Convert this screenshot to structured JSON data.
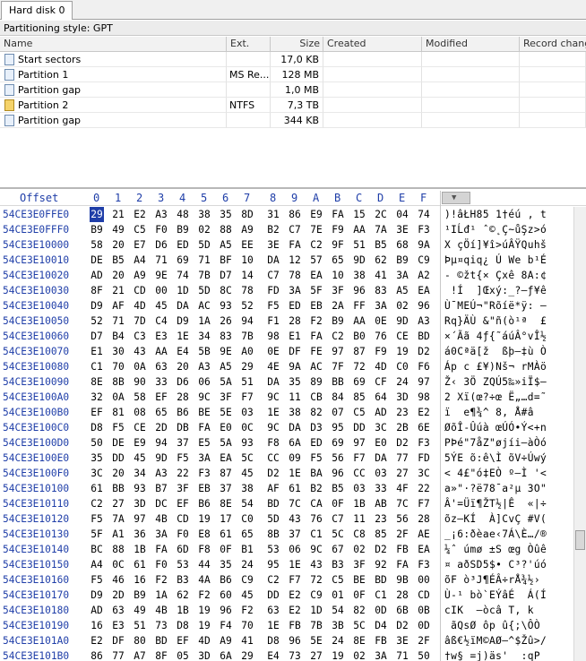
{
  "tab": {
    "label": "Hard disk 0"
  },
  "partition_style": "Partitioning style: GPT",
  "columns": [
    "Name",
    "Ext.",
    "Size",
    "Created",
    "Modified",
    "Record change"
  ],
  "partitions": [
    {
      "name": "Start sectors",
      "fs": "",
      "size": "17,0 KB",
      "icon": "sector-icon"
    },
    {
      "name": "Partition 1",
      "fs": "MS Re...",
      "size": "128 MB",
      "icon": "partition-icon"
    },
    {
      "name": "Partition gap",
      "fs": "",
      "size": "1,0 MB",
      "icon": "gap-icon"
    },
    {
      "name": "Partition 2",
      "fs": "NTFS",
      "size": "7,3 TB",
      "icon": "partition-warning-icon"
    },
    {
      "name": "Partition gap",
      "fs": "",
      "size": "344 KB",
      "icon": "gap-icon"
    }
  ],
  "hex": {
    "offset_label": "Offset",
    "col_labels": [
      "0",
      "1",
      "2",
      "3",
      "4",
      "5",
      "6",
      "7",
      "8",
      "9",
      "A",
      "B",
      "C",
      "D",
      "E",
      "F"
    ],
    "rows": [
      {
        "off": "54CE3E0FFE0",
        "bytes": [
          "29",
          "21",
          "E2",
          "A3",
          "48",
          "38",
          "35",
          "8D",
          "31",
          "86",
          "E9",
          "FA",
          "15",
          "2C",
          "04",
          "74"
        ],
        "ascii": ")!âŁH85 1†éú , t"
      },
      {
        "off": "54CE3E0FFF0",
        "bytes": [
          "B9",
          "49",
          "C5",
          "F0",
          "B9",
          "02",
          "88",
          "A9",
          "B2",
          "C7",
          "7E",
          "F9",
          "AA",
          "7A",
          "3E",
          "F3"
        ],
        "ascii": "¹IĹđ¹ ˆ©˛Ç~ůŞz>ó"
      },
      {
        "off": "54CE3E10000",
        "bytes": [
          "58",
          "20",
          "E7",
          "D6",
          "ED",
          "5D",
          "A5",
          "EE",
          "3E",
          "FA",
          "C2",
          "9F",
          "51",
          "B5",
          "68",
          "9A"
        ],
        "ascii": "X çÖí]¥î>úÂŸQuhš"
      },
      {
        "off": "54CE3E10010",
        "bytes": [
          "DE",
          "B5",
          "A4",
          "71",
          "69",
          "71",
          "BF",
          "10",
          "DA",
          "12",
          "57",
          "65",
          "9D",
          "62",
          "B9",
          "C9"
        ],
        "ascii": "Þµ¤qiq¿ Ú We b¹É"
      },
      {
        "off": "54CE3E10020",
        "bytes": [
          "AD",
          "20",
          "A9",
          "9E",
          "74",
          "7B",
          "D7",
          "14",
          "C7",
          "78",
          "EA",
          "10",
          "38",
          "41",
          "3A",
          "A2"
        ],
        "ascii": "- ©žt{× Çxê 8A:¢"
      },
      {
        "off": "54CE3E10030",
        "bytes": [
          "8F",
          "21",
          "CD",
          "00",
          "1D",
          "5D",
          "8C",
          "78",
          "FD",
          "3A",
          "5F",
          "3F",
          "96",
          "83",
          "A5",
          "EA"
        ],
        "ascii": " !Í  ]Œxý:_?–ƒ¥ê"
      },
      {
        "off": "54CE3E10040",
        "bytes": [
          "D9",
          "AF",
          "4D",
          "45",
          "DA",
          "AC",
          "93",
          "52",
          "F5",
          "ED",
          "EB",
          "2A",
          "FF",
          "3A",
          "02",
          "96"
        ],
        "ascii": "Ù¯MEÚ¬\"Rõíë*ÿ: –"
      },
      {
        "off": "54CE3E10050",
        "bytes": [
          "52",
          "71",
          "7D",
          "C4",
          "D9",
          "1A",
          "26",
          "94",
          "F1",
          "28",
          "F2",
          "B9",
          "AA",
          "0E",
          "9D",
          "A3"
        ],
        "ascii": "Rq}ÄÙ &\"ñ(ò¹ª  £"
      },
      {
        "off": "54CE3E10060",
        "bytes": [
          "D7",
          "B4",
          "C3",
          "E3",
          "1E",
          "34",
          "83",
          "7B",
          "98",
          "E1",
          "FA",
          "C2",
          "B0",
          "76",
          "CE",
          "BD"
        ],
        "ascii": "×´Ãã 4ƒ{˜áúÂ°vÎ½"
      },
      {
        "off": "54CE3E10070",
        "bytes": [
          "E1",
          "30",
          "43",
          "AA",
          "E4",
          "5B",
          "9E",
          "A0",
          "0E",
          "DF",
          "FE",
          "97",
          "87",
          "F9",
          "19",
          "D2"
        ],
        "ascii": "á0Cªä[ž  ßþ—‡ù Ò"
      },
      {
        "off": "54CE3E10080",
        "bytes": [
          "C1",
          "70",
          "0A",
          "63",
          "20",
          "A3",
          "A5",
          "29",
          "4E",
          "9A",
          "AC",
          "7F",
          "72",
          "4D",
          "C0",
          "F6"
        ],
        "ascii": "Áp c £¥)Nš¬ rMÀö"
      },
      {
        "off": "54CE3E10090",
        "bytes": [
          "8E",
          "8B",
          "90",
          "33",
          "D6",
          "06",
          "5A",
          "51",
          "DA",
          "35",
          "89",
          "BB",
          "69",
          "CF",
          "24",
          "97"
        ],
        "ascii": "Ž‹ 3Ö ZQÚ5‰»iÏ$—"
      },
      {
        "off": "54CE3E100A0",
        "bytes": [
          "32",
          "0A",
          "58",
          "EF",
          "28",
          "9C",
          "3F",
          "F7",
          "9C",
          "11",
          "CB",
          "84",
          "85",
          "64",
          "3D",
          "98"
        ],
        "ascii": "2 Xï(œ?÷œ Ë„…d=˜"
      },
      {
        "off": "54CE3E100B0",
        "bytes": [
          "EF",
          "81",
          "08",
          "65",
          "B6",
          "BE",
          "5E",
          "03",
          "1E",
          "38",
          "82",
          "07",
          "C5",
          "AD",
          "23",
          "E2"
        ],
        "ascii": "ï  e¶¾^ 8‚ Å­#â"
      },
      {
        "off": "54CE3E100C0",
        "bytes": [
          "D8",
          "F5",
          "CE",
          "2D",
          "DB",
          "FA",
          "E0",
          "0C",
          "9C",
          "DA",
          "D3",
          "95",
          "DD",
          "3C",
          "2B",
          "6E"
        ],
        "ascii": "ØõÎ-Ûúà œÚÓ•Ý<+n"
      },
      {
        "off": "54CE3E100D0",
        "bytes": [
          "50",
          "DE",
          "E9",
          "94",
          "37",
          "E5",
          "5A",
          "93",
          "F8",
          "6A",
          "ED",
          "69",
          "97",
          "E0",
          "D2",
          "F3"
        ],
        "ascii": "PÞé\"7åZ\"øjíi—àÒó"
      },
      {
        "off": "54CE3E100E0",
        "bytes": [
          "35",
          "DD",
          "45",
          "9D",
          "F5",
          "3A",
          "EA",
          "5C",
          "CC",
          "09",
          "F5",
          "56",
          "F7",
          "DA",
          "77",
          "FD"
        ],
        "ascii": "5ÝE õ:ê\\Ì õV÷Úwý"
      },
      {
        "off": "54CE3E100F0",
        "bytes": [
          "3C",
          "20",
          "34",
          "A3",
          "22",
          "F3",
          "87",
          "45",
          "D2",
          "1E",
          "BA",
          "96",
          "CC",
          "03",
          "27",
          "3C"
        ],
        "ascii": "< 4£\"ó‡EÒ º–Ì '<"
      },
      {
        "off": "54CE3E10100",
        "bytes": [
          "61",
          "BB",
          "93",
          "B7",
          "3F",
          "EB",
          "37",
          "38",
          "AF",
          "61",
          "B2",
          "B5",
          "03",
          "33",
          "4F",
          "22"
        ],
        "ascii": "a»\"·?ë78¯a²µ 3O\""
      },
      {
        "off": "54CE3E10110",
        "bytes": [
          "C2",
          "27",
          "3D",
          "DC",
          "EF",
          "B6",
          "8E",
          "54",
          "BD",
          "7C",
          "CA",
          "0F",
          "1B",
          "AB",
          "7C",
          "F7"
        ],
        "ascii": "Â'=Üï¶ŽT½|Ê  «|÷"
      },
      {
        "off": "54CE3E10120",
        "bytes": [
          "F5",
          "7A",
          "97",
          "4B",
          "CD",
          "19",
          "17",
          "C0",
          "5D",
          "43",
          "76",
          "C7",
          "11",
          "23",
          "56",
          "28"
        ],
        "ascii": "õz—KÍ  À]CvÇ #V("
      },
      {
        "off": "54CE3E10130",
        "bytes": [
          "5F",
          "A1",
          "36",
          "3A",
          "F0",
          "E8",
          "61",
          "65",
          "8B",
          "37",
          "C1",
          "5C",
          "C8",
          "85",
          "2F",
          "AE"
        ],
        "ascii": "_¡6:ðèae‹7Á\\È…/®"
      },
      {
        "off": "54CE3E10140",
        "bytes": [
          "BC",
          "88",
          "1B",
          "FA",
          "6D",
          "F8",
          "0F",
          "B1",
          "53",
          "06",
          "9C",
          "67",
          "02",
          "D2",
          "FB",
          "EA"
        ],
        "ascii": "¼ˆ úmø ±S œg Òûê"
      },
      {
        "off": "54CE3E10150",
        "bytes": [
          "A4",
          "0C",
          "61",
          "F0",
          "53",
          "44",
          "35",
          "24",
          "95",
          "1E",
          "43",
          "B3",
          "3F",
          "92",
          "FA",
          "F3"
        ],
        "ascii": "¤ aðSD5$• C³?'úó"
      },
      {
        "off": "54CE3E10160",
        "bytes": [
          "F5",
          "46",
          "16",
          "F2",
          "B3",
          "4A",
          "B6",
          "C9",
          "C2",
          "F7",
          "72",
          "C5",
          "BE",
          "BD",
          "9B",
          "00"
        ],
        "ascii": "õF ò³J¶ÉÂ÷rÅ¾½› "
      },
      {
        "off": "54CE3E10170",
        "bytes": [
          "D9",
          "2D",
          "B9",
          "1A",
          "62",
          "F2",
          "60",
          "45",
          "DD",
          "E2",
          "C9",
          "01",
          "0F",
          "C1",
          "28",
          "CD"
        ],
        "ascii": "Ù-¹ bò`EÝâÉ  Á(Í"
      },
      {
        "off": "54CE3E10180",
        "bytes": [
          "AD",
          "63",
          "49",
          "4B",
          "1B",
          "19",
          "96",
          "F2",
          "63",
          "E2",
          "1D",
          "54",
          "82",
          "0D",
          "6B",
          "0B"
        ],
        "ascii": "­cIK  –òcâ T‚ k "
      },
      {
        "off": "54CE3E10190",
        "bytes": [
          "16",
          "E3",
          "51",
          "73",
          "D8",
          "19",
          "F4",
          "70",
          "1E",
          "FB",
          "7B",
          "3B",
          "5C",
          "D4",
          "D2",
          "0D"
        ],
        "ascii": " ãQsØ ôp û{;\\ÔÒ "
      },
      {
        "off": "54CE3E101A0",
        "bytes": [
          "E2",
          "DF",
          "80",
          "BD",
          "EF",
          "4D",
          "A9",
          "41",
          "D8",
          "96",
          "5E",
          "24",
          "8E",
          "FB",
          "3E",
          "2F"
        ],
        "ascii": "âß€½ïM©AØ–^$Žû>/"
      },
      {
        "off": "54CE3E101B0",
        "bytes": [
          "86",
          "77",
          "A7",
          "8F",
          "05",
          "3D",
          "6A",
          "29",
          "E4",
          "73",
          "27",
          "19",
          "02",
          "3A",
          "71",
          "50"
        ],
        "ascii": "†w§ =j)äs'  :qP"
      }
    ]
  }
}
